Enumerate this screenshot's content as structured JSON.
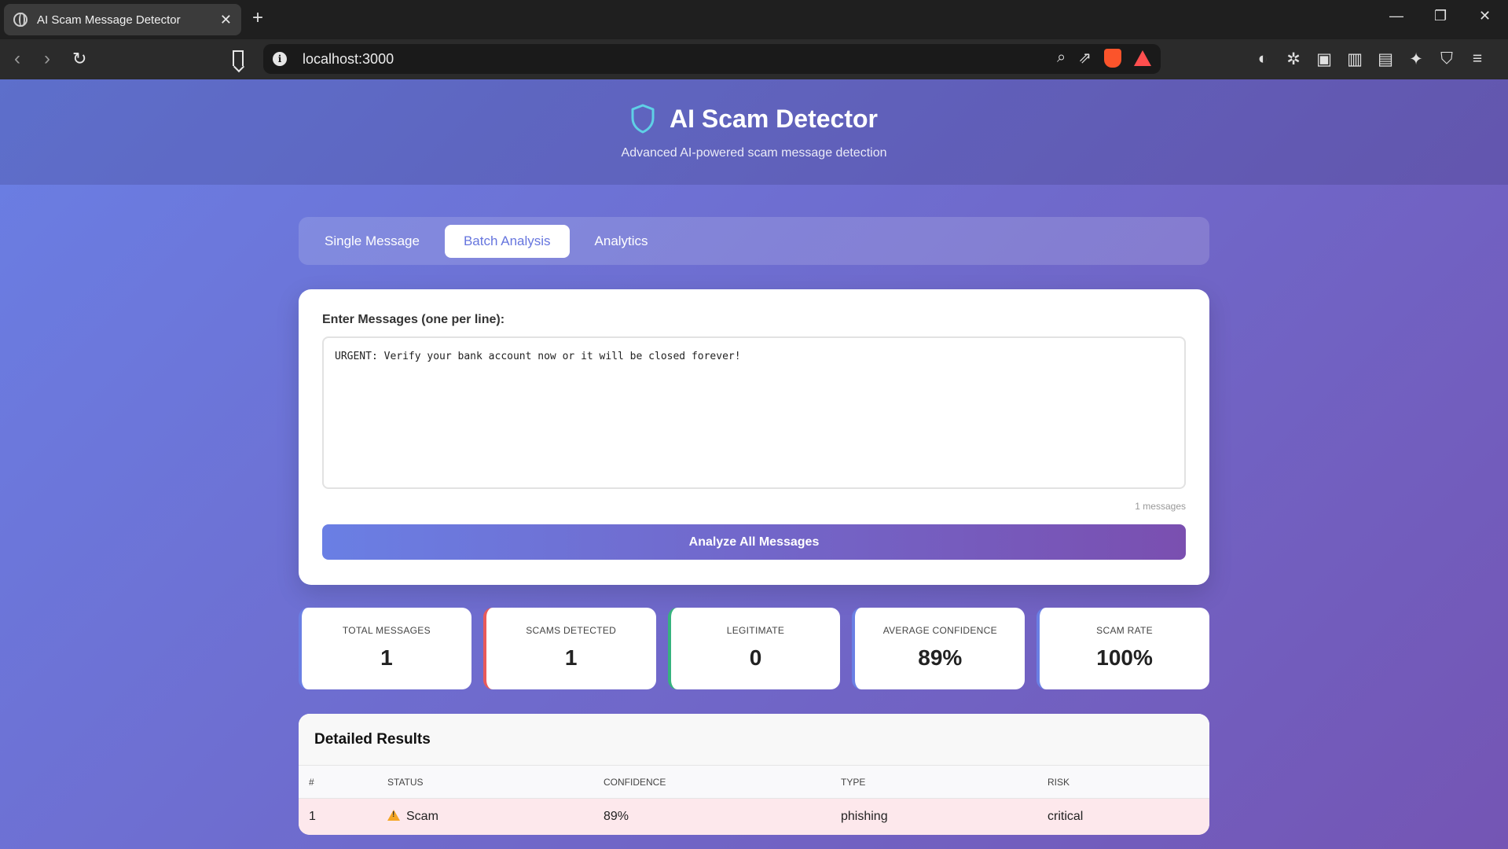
{
  "browser": {
    "tab_title": "AI Scam Message Detector",
    "new_tab": "+",
    "url": "localhost:3000",
    "window_controls": {
      "minimize": "—",
      "restore": "❐",
      "close": "✕"
    },
    "tab_close": "✕"
  },
  "header": {
    "title": "AI Scam Detector",
    "subtitle": "Advanced AI-powered scam message detection"
  },
  "tabs": [
    {
      "label": "Single Message",
      "active": false
    },
    {
      "label": "Batch Analysis",
      "active": true
    },
    {
      "label": "Analytics",
      "active": false
    }
  ],
  "input": {
    "label": "Enter Messages (one per line):",
    "value": "URGENT: Verify your bank account now or it will be closed forever!",
    "counter": "1 messages",
    "button": "Analyze All Messages"
  },
  "stats": [
    {
      "label": "TOTAL MESSAGES",
      "value": "1",
      "accent": "#6a7fe4"
    },
    {
      "label": "SCAMS DETECTED",
      "value": "1",
      "accent": "#e85a5a"
    },
    {
      "label": "LEGITIMATE",
      "value": "0",
      "accent": "#36b37e"
    },
    {
      "label": "AVERAGE CONFIDENCE",
      "value": "89%",
      "accent": "#6a7fe4"
    },
    {
      "label": "SCAM RATE",
      "value": "100%",
      "accent": "#6a7fe4"
    }
  ],
  "results": {
    "title": "Detailed Results",
    "columns": [
      "#",
      "STATUS",
      "CONFIDENCE",
      "TYPE",
      "RISK"
    ],
    "rows": [
      {
        "index": "1",
        "status": "Scam",
        "confidence": "89%",
        "type": "phishing",
        "risk": "critical"
      }
    ]
  },
  "colors": {
    "gradient_start": "#6a7fe4",
    "gradient_end": "#7455b4",
    "active_tab_text": "#6675de",
    "scam_row_bg": "#fde8ec",
    "shield_color": "#5fd0e6"
  }
}
